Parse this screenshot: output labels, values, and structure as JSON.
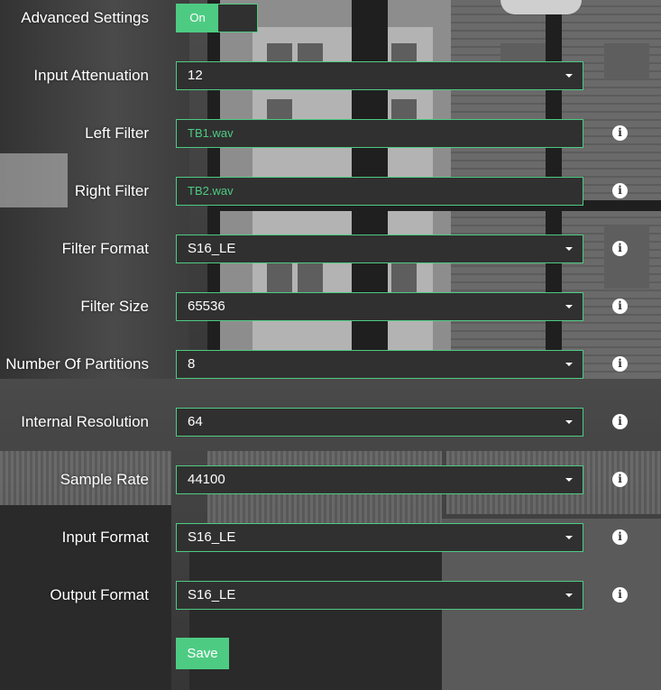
{
  "advanced_settings": {
    "label": "Advanced Settings",
    "toggle_label": "On",
    "enabled": true
  },
  "fields": [
    {
      "id": "input-attenuation",
      "label": "Input Attenuation",
      "value": "12",
      "kind": "select",
      "info": false
    },
    {
      "id": "left-filter",
      "label": "Left Filter",
      "value": "TB1.wav",
      "kind": "text",
      "info": true
    },
    {
      "id": "right-filter",
      "label": "Right Filter",
      "value": "TB2.wav",
      "kind": "text",
      "info": true
    },
    {
      "id": "filter-format",
      "label": "Filter Format",
      "value": "S16_LE",
      "kind": "select",
      "info": true
    },
    {
      "id": "filter-size",
      "label": "Filter Size",
      "value": "65536",
      "kind": "select",
      "info": true
    },
    {
      "id": "number-of-partitions",
      "label": "Number Of Partitions",
      "value": "8",
      "kind": "select",
      "info": true
    },
    {
      "id": "internal-resolution",
      "label": "Internal Resolution",
      "value": "64",
      "kind": "select",
      "info": true
    },
    {
      "id": "sample-rate",
      "label": "Sample Rate",
      "value": "44100",
      "kind": "select",
      "info": true
    },
    {
      "id": "input-format",
      "label": "Input Format",
      "value": "S16_LE",
      "kind": "select",
      "info": true
    },
    {
      "id": "output-format",
      "label": "Output Format",
      "value": "S16_LE",
      "kind": "select",
      "info": true
    }
  ],
  "save_label": "Save",
  "info_glyph": "i",
  "icons": {
    "info": "info-circle-icon",
    "caret": "caret-down-icon"
  },
  "colors": {
    "accent": "#4ecb83",
    "field_bg": "#303030",
    "text": "#ffffff"
  }
}
